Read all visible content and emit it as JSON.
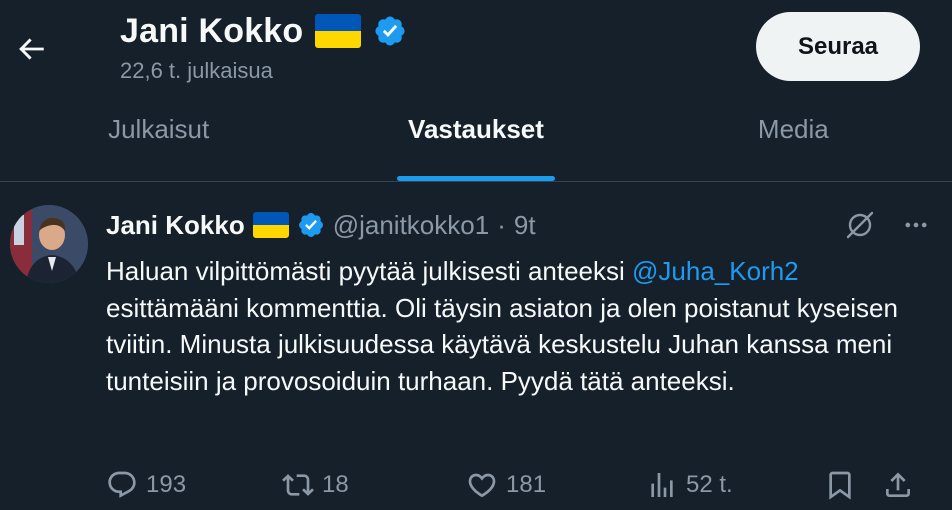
{
  "header": {
    "back_icon": "arrow-left-icon",
    "name": "Jani Kokko",
    "flag_icon": "ukraine-flag-icon",
    "flag_colors": {
      "blue": "#0057b7",
      "yellow": "#ffd700"
    },
    "verified_icon": "verified-badge-icon",
    "post_count": "22,6 t. julkaisua",
    "follow_label": "Seuraa"
  },
  "tabs": [
    {
      "label": "Julkaisut",
      "active": false
    },
    {
      "label": "Vastaukset",
      "active": true
    },
    {
      "label": "Media",
      "active": false
    }
  ],
  "tweet": {
    "name": "Jani Kokko",
    "handle": "@janitkokko1",
    "separator": "·",
    "time": "9t",
    "text_before": "Haluan vilpittömästi pyytää julkisesti anteeksi ",
    "mention": "@Juha_Korh2",
    "text_after": " esittämääni kommenttia. Oli täysin asiaton ja olen poistanut kyseisen tviitin. Minusta julkisuudessa käytävä keskustelu Juhan kanssa meni tunteisiin ja provosoiduin turhaan. Pyydä tätä anteeksi.",
    "actions": {
      "replies": "193",
      "reposts": "18",
      "likes": "181",
      "views": "52 t."
    }
  },
  "colors": {
    "background": "#15202b",
    "accent": "#1d9bf0",
    "muted_text": "#8b98a5",
    "divider": "#38444d"
  }
}
